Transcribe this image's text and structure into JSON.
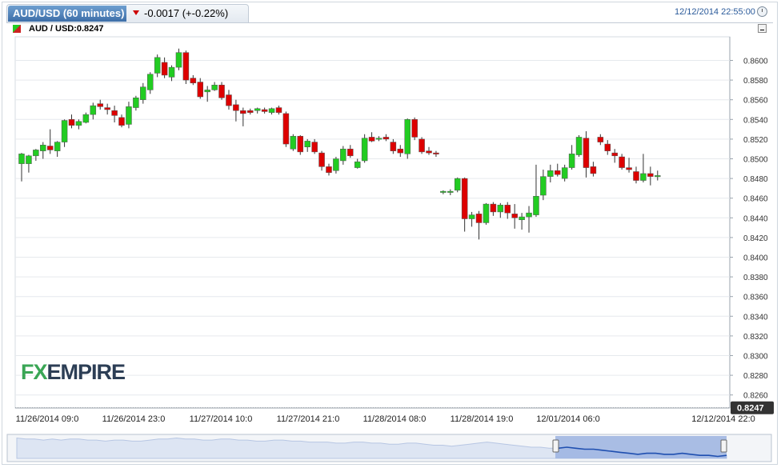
{
  "header": {
    "symbol_tab": "AUD/USD (60 minutes)",
    "change_text": "-0.0017 (+-0.22%)",
    "datetime": "12/12/2014 22:55:00"
  },
  "legend": {
    "label": "AUD / USD:0.8247"
  },
  "logo": {
    "part1": "FX",
    "part2": "EMPIRE"
  },
  "colors": {
    "up": "#22cc22",
    "down": "#dd0000",
    "tab": "#3d6ea8",
    "price_box": "#333333",
    "navigator_fill": "#9bb3e0",
    "navigator_line": "#1f4fb0"
  },
  "chart_data": {
    "type": "candlestick",
    "title": "AUD/USD (60 minutes)",
    "ylim": [
      0.8247,
      0.8612
    ],
    "yticks": [
      "0.8600",
      "0.8580",
      "0.8560",
      "0.8540",
      "0.8520",
      "0.8500",
      "0.8480",
      "0.8460",
      "0.8440",
      "0.8420",
      "0.8400",
      "0.8380",
      "0.8360",
      "0.8340",
      "0.8320",
      "0.8300",
      "0.8280",
      "0.8260"
    ],
    "xtick_labels": [
      "11/26/2014 09:0",
      "11/26/2014 23:0",
      "11/27/2014 10:0",
      "11/27/2014 21:0",
      "11/28/2014 08:0",
      "11/28/2014 19:0",
      "12/01/2014 06:0",
      "12/12/2014 22:0"
    ],
    "last_price": "0.8247",
    "candles": [
      {
        "o": 0.8495,
        "h": 0.8506,
        "l": 0.8477,
        "c": 0.8505
      },
      {
        "o": 0.8495,
        "h": 0.8504,
        "l": 0.8486,
        "c": 0.8503
      },
      {
        "o": 0.8503,
        "h": 0.851,
        "l": 0.8498,
        "c": 0.8509
      },
      {
        "o": 0.8508,
        "h": 0.8517,
        "l": 0.85,
        "c": 0.8514
      },
      {
        "o": 0.8513,
        "h": 0.853,
        "l": 0.8505,
        "c": 0.8509
      },
      {
        "o": 0.8508,
        "h": 0.8518,
        "l": 0.8502,
        "c": 0.8517
      },
      {
        "o": 0.8517,
        "h": 0.854,
        "l": 0.8512,
        "c": 0.8539
      },
      {
        "o": 0.854,
        "h": 0.8545,
        "l": 0.8531,
        "c": 0.8534
      },
      {
        "o": 0.8534,
        "h": 0.854,
        "l": 0.853,
        "c": 0.8538
      },
      {
        "o": 0.8537,
        "h": 0.8547,
        "l": 0.8536,
        "c": 0.8545
      },
      {
        "o": 0.8545,
        "h": 0.8557,
        "l": 0.854,
        "c": 0.8554
      },
      {
        "o": 0.8556,
        "h": 0.856,
        "l": 0.855,
        "c": 0.8553
      },
      {
        "o": 0.8552,
        "h": 0.8556,
        "l": 0.8545,
        "c": 0.855
      },
      {
        "o": 0.8549,
        "h": 0.8554,
        "l": 0.8537,
        "c": 0.8544
      },
      {
        "o": 0.8542,
        "h": 0.8545,
        "l": 0.8532,
        "c": 0.8534
      },
      {
        "o": 0.8535,
        "h": 0.8558,
        "l": 0.8531,
        "c": 0.8553
      },
      {
        "o": 0.8552,
        "h": 0.8564,
        "l": 0.8549,
        "c": 0.8562
      },
      {
        "o": 0.856,
        "h": 0.8577,
        "l": 0.8556,
        "c": 0.8573
      },
      {
        "o": 0.857,
        "h": 0.8588,
        "l": 0.8566,
        "c": 0.8586
      },
      {
        "o": 0.8587,
        "h": 0.8606,
        "l": 0.8583,
        "c": 0.8603
      },
      {
        "o": 0.8598,
        "h": 0.8603,
        "l": 0.8582,
        "c": 0.8585
      },
      {
        "o": 0.8583,
        "h": 0.8595,
        "l": 0.8579,
        "c": 0.8593
      },
      {
        "o": 0.8593,
        "h": 0.8612,
        "l": 0.859,
        "c": 0.8608
      },
      {
        "o": 0.8608,
        "h": 0.861,
        "l": 0.8576,
        "c": 0.858
      },
      {
        "o": 0.8582,
        "h": 0.8585,
        "l": 0.8575,
        "c": 0.8577
      },
      {
        "o": 0.8578,
        "h": 0.8582,
        "l": 0.8561,
        "c": 0.8563
      },
      {
        "o": 0.8568,
        "h": 0.8574,
        "l": 0.8558,
        "c": 0.857
      },
      {
        "o": 0.857,
        "h": 0.8578,
        "l": 0.8569,
        "c": 0.8575
      },
      {
        "o": 0.8575,
        "h": 0.8578,
        "l": 0.856,
        "c": 0.8562
      },
      {
        "o": 0.8565,
        "h": 0.857,
        "l": 0.855,
        "c": 0.8554
      },
      {
        "o": 0.8555,
        "h": 0.856,
        "l": 0.8538,
        "c": 0.8549
      },
      {
        "o": 0.8549,
        "h": 0.8552,
        "l": 0.8533,
        "c": 0.8546
      },
      {
        "o": 0.8549,
        "h": 0.8551,
        "l": 0.8545,
        "c": 0.8547
      },
      {
        "o": 0.8549,
        "h": 0.8552,
        "l": 0.8546,
        "c": 0.8551
      },
      {
        "o": 0.855,
        "h": 0.8552,
        "l": 0.8546,
        "c": 0.8548
      },
      {
        "o": 0.8547,
        "h": 0.8552,
        "l": 0.8545,
        "c": 0.8551
      },
      {
        "o": 0.8552,
        "h": 0.8554,
        "l": 0.8545,
        "c": 0.8547
      },
      {
        "o": 0.8546,
        "h": 0.8548,
        "l": 0.8512,
        "c": 0.8515
      },
      {
        "o": 0.851,
        "h": 0.8525,
        "l": 0.8508,
        "c": 0.8523
      },
      {
        "o": 0.8523,
        "h": 0.8524,
        "l": 0.8504,
        "c": 0.8507
      },
      {
        "o": 0.8512,
        "h": 0.852,
        "l": 0.8507,
        "c": 0.8518
      },
      {
        "o": 0.8517,
        "h": 0.852,
        "l": 0.8505,
        "c": 0.8507
      },
      {
        "o": 0.8506,
        "h": 0.8508,
        "l": 0.8488,
        "c": 0.8492
      },
      {
        "o": 0.8492,
        "h": 0.8495,
        "l": 0.8483,
        "c": 0.8486
      },
      {
        "o": 0.8488,
        "h": 0.8502,
        "l": 0.8485,
        "c": 0.85
      },
      {
        "o": 0.8498,
        "h": 0.8513,
        "l": 0.8494,
        "c": 0.851
      },
      {
        "o": 0.851,
        "h": 0.8514,
        "l": 0.8501,
        "c": 0.8503
      },
      {
        "o": 0.8491,
        "h": 0.85,
        "l": 0.849,
        "c": 0.8497
      },
      {
        "o": 0.8498,
        "h": 0.8525,
        "l": 0.8496,
        "c": 0.8521
      },
      {
        "o": 0.8522,
        "h": 0.8527,
        "l": 0.8517,
        "c": 0.8518
      },
      {
        "o": 0.852,
        "h": 0.8523,
        "l": 0.8518,
        "c": 0.8521
      },
      {
        "o": 0.8522,
        "h": 0.8525,
        "l": 0.8518,
        "c": 0.852
      },
      {
        "o": 0.8517,
        "h": 0.852,
        "l": 0.8505,
        "c": 0.8508
      },
      {
        "o": 0.851,
        "h": 0.8514,
        "l": 0.8502,
        "c": 0.8506
      },
      {
        "o": 0.8505,
        "h": 0.8541,
        "l": 0.85,
        "c": 0.854
      },
      {
        "o": 0.854,
        "h": 0.8542,
        "l": 0.8519,
        "c": 0.8522
      },
      {
        "o": 0.852,
        "h": 0.8522,
        "l": 0.8505,
        "c": 0.8507
      },
      {
        "o": 0.8508,
        "h": 0.8512,
        "l": 0.8504,
        "c": 0.8506
      },
      {
        "o": 0.8506,
        "h": 0.8508,
        "l": 0.8502,
        "c": 0.8505
      },
      {
        "o": 0.8466,
        "h": 0.8468,
        "l": 0.8464,
        "c": 0.8467
      },
      {
        "o": 0.8466,
        "h": 0.8469,
        "l": 0.8463,
        "c": 0.8467
      },
      {
        "o": 0.8468,
        "h": 0.8481,
        "l": 0.8466,
        "c": 0.848
      },
      {
        "o": 0.848,
        "h": 0.8481,
        "l": 0.8426,
        "c": 0.8439
      },
      {
        "o": 0.8439,
        "h": 0.8446,
        "l": 0.8431,
        "c": 0.8443
      },
      {
        "o": 0.8444,
        "h": 0.8447,
        "l": 0.8418,
        "c": 0.8435
      },
      {
        "o": 0.8435,
        "h": 0.8455,
        "l": 0.8433,
        "c": 0.8454
      },
      {
        "o": 0.8454,
        "h": 0.8456,
        "l": 0.8442,
        "c": 0.8446
      },
      {
        "o": 0.8446,
        "h": 0.8455,
        "l": 0.844,
        "c": 0.8453
      },
      {
        "o": 0.8453,
        "h": 0.8456,
        "l": 0.8439,
        "c": 0.8445
      },
      {
        "o": 0.8444,
        "h": 0.8454,
        "l": 0.8429,
        "c": 0.844
      },
      {
        "o": 0.8438,
        "h": 0.8445,
        "l": 0.8428,
        "c": 0.8441
      },
      {
        "o": 0.8441,
        "h": 0.8452,
        "l": 0.8425,
        "c": 0.8445
      },
      {
        "o": 0.8443,
        "h": 0.8494,
        "l": 0.8441,
        "c": 0.8462
      },
      {
        "o": 0.8463,
        "h": 0.8489,
        "l": 0.8458,
        "c": 0.8482
      },
      {
        "o": 0.8482,
        "h": 0.8494,
        "l": 0.8476,
        "c": 0.8488
      },
      {
        "o": 0.8488,
        "h": 0.8495,
        "l": 0.8482,
        "c": 0.8484
      },
      {
        "o": 0.848,
        "h": 0.8494,
        "l": 0.8477,
        "c": 0.8491
      },
      {
        "o": 0.8491,
        "h": 0.8514,
        "l": 0.8489,
        "c": 0.8505
      },
      {
        "o": 0.8504,
        "h": 0.8524,
        "l": 0.8502,
        "c": 0.8522
      },
      {
        "o": 0.8521,
        "h": 0.8528,
        "l": 0.8481,
        "c": 0.8491
      },
      {
        "o": 0.8492,
        "h": 0.8497,
        "l": 0.8482,
        "c": 0.8485
      },
      {
        "o": 0.8522,
        "h": 0.8525,
        "l": 0.8514,
        "c": 0.8517
      },
      {
        "o": 0.8515,
        "h": 0.8519,
        "l": 0.8504,
        "c": 0.8508
      },
      {
        "o": 0.8506,
        "h": 0.851,
        "l": 0.8496,
        "c": 0.8503
      },
      {
        "o": 0.8502,
        "h": 0.8505,
        "l": 0.8489,
        "c": 0.8491
      },
      {
        "o": 0.8491,
        "h": 0.8501,
        "l": 0.8486,
        "c": 0.8489
      },
      {
        "o": 0.8487,
        "h": 0.8492,
        "l": 0.8475,
        "c": 0.8478
      },
      {
        "o": 0.8478,
        "h": 0.8505,
        "l": 0.8476,
        "c": 0.8485
      },
      {
        "o": 0.8485,
        "h": 0.8492,
        "l": 0.8473,
        "c": 0.8482
      },
      {
        "o": 0.8482,
        "h": 0.8488,
        "l": 0.8478,
        "c": 0.8483
      }
    ],
    "navigator": [
      0.862,
      0.861,
      0.861,
      0.86,
      0.861,
      0.86,
      0.861,
      0.861,
      0.86,
      0.86,
      0.859,
      0.86,
      0.86,
      0.859,
      0.859,
      0.86,
      0.861,
      0.861,
      0.862,
      0.861,
      0.861,
      0.86,
      0.86,
      0.861,
      0.861,
      0.86,
      0.86,
      0.859,
      0.859,
      0.86,
      0.86,
      0.859,
      0.859,
      0.858,
      0.858,
      0.858,
      0.857,
      0.857,
      0.858,
      0.858,
      0.857,
      0.857,
      0.856,
      0.856,
      0.857,
      0.857,
      0.856,
      0.855,
      0.855,
      0.854,
      0.855,
      0.856,
      0.857,
      0.858,
      0.857,
      0.856,
      0.855,
      0.854,
      0.853,
      0.853,
      0.852,
      0.852,
      0.853,
      0.852,
      0.851,
      0.851,
      0.85,
      0.849,
      0.848,
      0.847,
      0.846,
      0.847,
      0.847,
      0.846,
      0.846,
      0.847,
      0.846,
      0.845,
      0.845,
      0.844,
      0.845
    ]
  }
}
